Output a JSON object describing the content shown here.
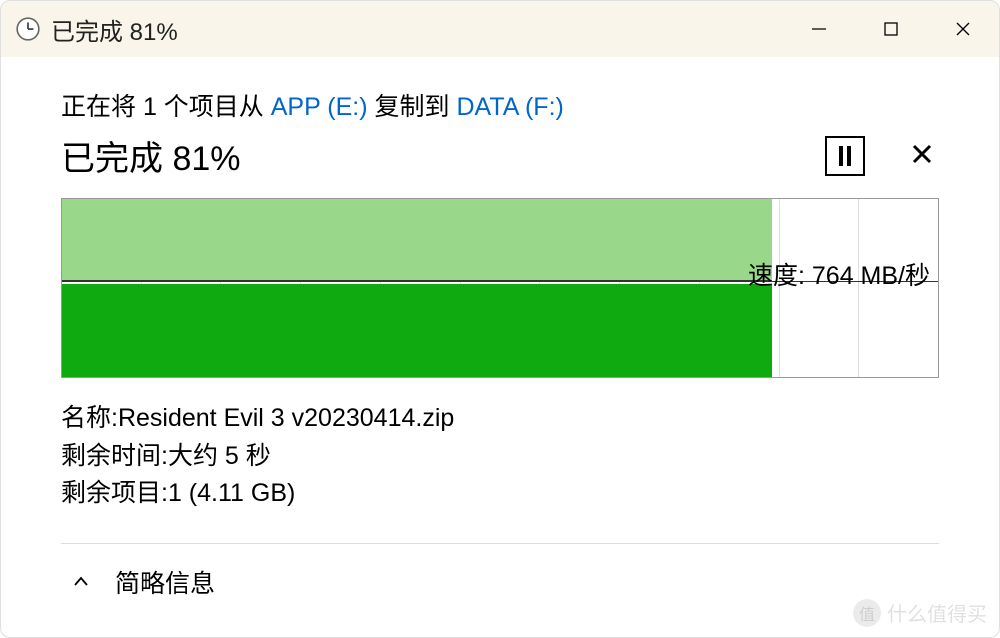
{
  "titlebar": {
    "title": "已完成 81%"
  },
  "copy": {
    "prefix": "正在将 1 个项目从 ",
    "source": "APP (E:)",
    "mid": " 复制到 ",
    "dest": "DATA (F:)"
  },
  "progress": {
    "text": "已完成 81%",
    "percent": 81
  },
  "chart_data": {
    "type": "area",
    "title": "",
    "xlabel": "",
    "ylabel": "",
    "progress_percent": 81,
    "speed_label": "速度: 764 MB/秒",
    "series": [
      {
        "name": "speed",
        "values_relative": [
          0.54,
          0.54,
          0.54,
          0.54,
          0.54,
          0.54,
          0.54,
          0.54,
          0.54,
          0.54
        ]
      }
    ],
    "grid_columns": 11
  },
  "details": {
    "name_label": "名称: ",
    "name_value": "Resident Evil 3 v20230414.zip",
    "time_label": "剩余时间: ",
    "time_value": "大约 5 秒",
    "items_label": "剩余项目: ",
    "items_value": "1 (4.11 GB)"
  },
  "collapse": {
    "label": "简略信息"
  },
  "watermark": {
    "badge": "值",
    "text": "什么值得买"
  }
}
